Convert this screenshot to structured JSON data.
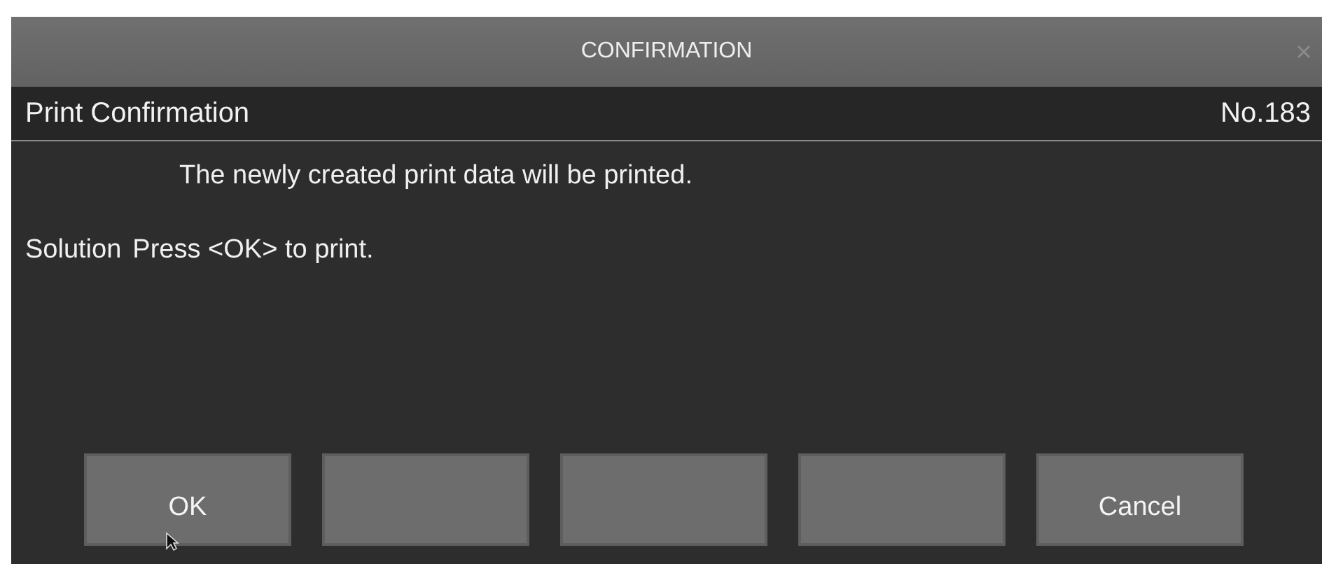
{
  "window": {
    "title": "CONFIRMATION"
  },
  "header": {
    "title": "Print Confirmation",
    "number": "No.183"
  },
  "message": "The newly created print data will be printed.",
  "solution": {
    "label": "Solution",
    "text": "Press <OK> to print."
  },
  "buttons": [
    {
      "kind": "labeled",
      "label": "OK"
    },
    {
      "kind": "blank"
    },
    {
      "kind": "blank"
    },
    {
      "kind": "blank"
    },
    {
      "kind": "labeled",
      "label": "Cancel"
    }
  ]
}
